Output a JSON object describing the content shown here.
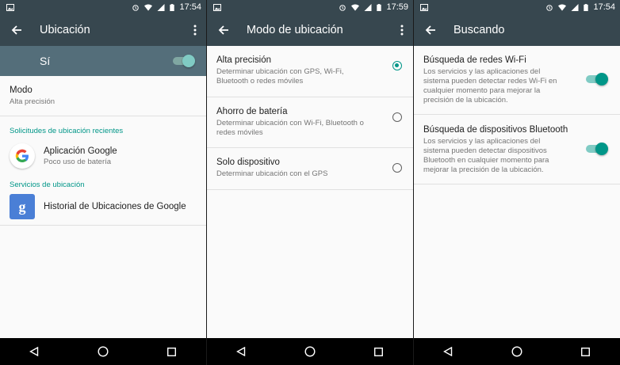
{
  "colors": {
    "primary_dark": "#37474f",
    "accent": "#009688",
    "master_bar": "#546e7a"
  },
  "screen1": {
    "status_time": "17:54",
    "title": "Ubicación",
    "master_label": "Sí",
    "mode_label": "Modo",
    "mode_value": "Alta precisión",
    "recent_header": "Solicitudes de ubicación recientes",
    "app_name": "Aplicación Google",
    "app_usage": "Poco uso de batería",
    "services_header": "Servicios de ubicación",
    "history_label": "Historial de Ubicaciones de Google"
  },
  "screen2": {
    "status_time": "17:59",
    "title": "Modo de ubicación",
    "options": [
      {
        "title": "Alta precisión",
        "desc": "Determinar ubicación con GPS, Wi-Fi, Bluetooth o redes móviles",
        "selected": true
      },
      {
        "title": "Ahorro de batería",
        "desc": "Determinar ubicación con Wi-Fi, Bluetooth o redes móviles",
        "selected": false
      },
      {
        "title": "Solo dispositivo",
        "desc": "Determinar ubicación con el GPS",
        "selected": false
      }
    ]
  },
  "screen3": {
    "status_time": "17:54",
    "title": "Buscando",
    "items": [
      {
        "title": "Búsqueda de redes Wi-Fi",
        "desc": "Los servicios y las aplicaciones del sistema pueden detectar redes Wi-Fi en cualquier momento para mejorar la precisión de la ubicación.",
        "on": true
      },
      {
        "title": "Búsqueda de dispositivos Bluetooth",
        "desc": "Los servicios y las aplicaciones del sistema pueden detectar dispositivos Bluetooth en cualquier momento para mejorar la precisión de la ubicación.",
        "on": true
      }
    ]
  }
}
